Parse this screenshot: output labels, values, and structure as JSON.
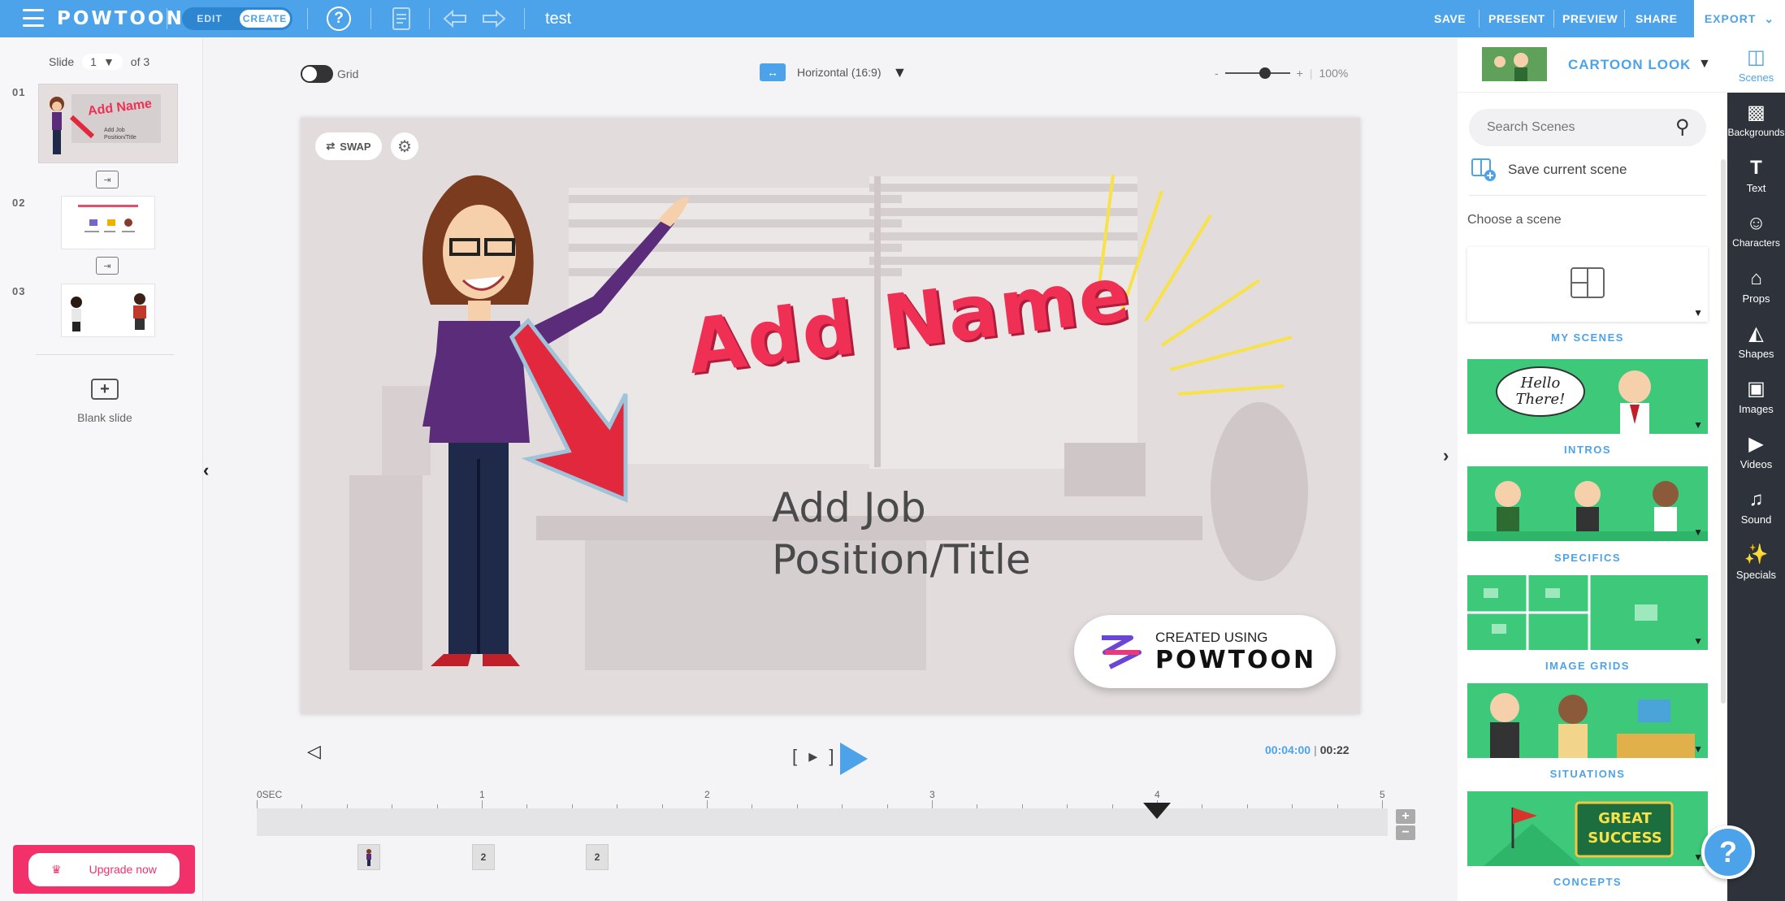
{
  "app": {
    "logo": "POWTOON",
    "document_name": "test"
  },
  "topbar": {
    "mode_edit": "EDIT",
    "mode_create": "CREATE",
    "help_glyph": "?",
    "actions": [
      "SAVE",
      "PRESENT",
      "PREVIEW",
      "SHARE"
    ],
    "export": "EXPORT",
    "accent_color": "#4da3e9"
  },
  "slides": {
    "label": "Slide",
    "current": "1",
    "of_label": "of 3",
    "items": [
      {
        "number": "01",
        "thumb_title": "Add Name",
        "thumb_sub": "Add Job Position/Title"
      },
      {
        "number": "02"
      },
      {
        "number": "03"
      }
    ],
    "blank_label": "Blank slide",
    "upgrade": "Upgrade now"
  },
  "canvas": {
    "grid_label": "Grid",
    "orientation": "Horizontal (16:9)",
    "zoom_minus": "-",
    "zoom_plus": "+",
    "zoom_level": "100%",
    "zoom_fraction": 0.62
  },
  "scene": {
    "swap_label": "SWAP",
    "title": "Add Name",
    "subtitle_line1": "Add Job",
    "subtitle_line2": "Position/Title",
    "watermark_top": "CREATED USING",
    "watermark_brand": "POWTOON",
    "title_color": "#ef3054"
  },
  "player": {
    "step_label": "[ ▸ ]",
    "current_time": "00:04:00",
    "total_time": "00:22",
    "time_sep": " | "
  },
  "timeline": {
    "labels": [
      "0SEC",
      "1",
      "2",
      "3",
      "4",
      "5"
    ],
    "playhead_seconds": 4,
    "zoom_in": "+",
    "zoom_out": "−",
    "items": [
      "",
      "2",
      "2"
    ]
  },
  "right_panel": {
    "style_label": "CARTOON LOOK",
    "search_placeholder": "Search Scenes",
    "save_scene": "Save current scene",
    "choose_label": "Choose a scene",
    "categories": [
      "MY SCENES",
      "INTROS",
      "SPECIFICS",
      "IMAGE GRIDS",
      "SITUATIONS",
      "CONCEPTS"
    ],
    "intro_bubble": "Hello There!",
    "concepts_sign": "GREAT SUCCESS"
  },
  "rail": [
    {
      "label": "Scenes",
      "icon": "scenes-icon"
    },
    {
      "label": "Backgrounds",
      "icon": "backgrounds-icon"
    },
    {
      "label": "Text",
      "icon": "text-icon"
    },
    {
      "label": "Characters",
      "icon": "characters-icon"
    },
    {
      "label": "Props",
      "icon": "props-icon"
    },
    {
      "label": "Shapes",
      "icon": "shapes-icon"
    },
    {
      "label": "Images",
      "icon": "images-icon"
    },
    {
      "label": "Videos",
      "icon": "videos-icon"
    },
    {
      "label": "Sound",
      "icon": "sound-icon"
    },
    {
      "label": "Specials",
      "icon": "specials-icon"
    }
  ],
  "help_fab": "?"
}
